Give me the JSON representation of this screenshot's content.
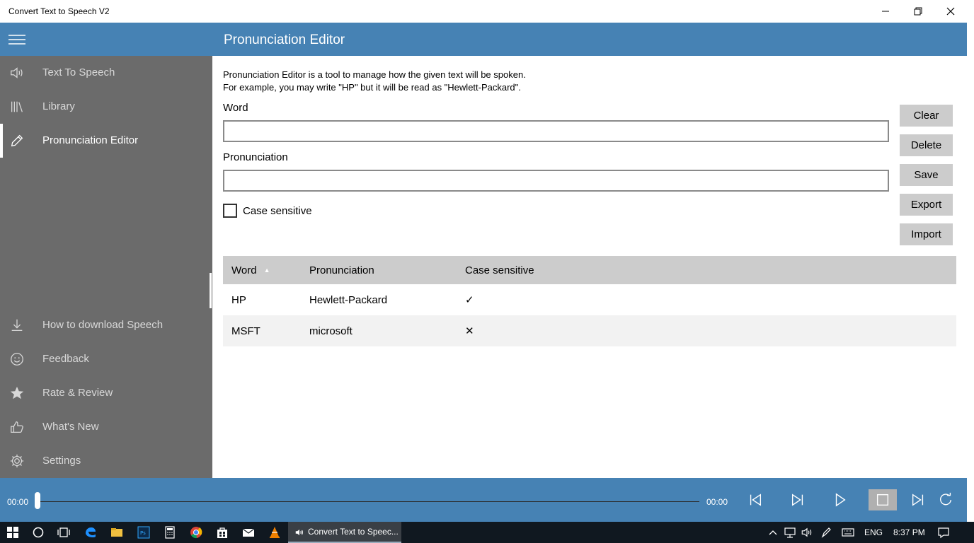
{
  "window": {
    "title": "Convert Text to Speech V2"
  },
  "header": {
    "title": "Pronunciation Editor"
  },
  "sidebar": {
    "top_items": [
      {
        "label": "Text To Speech",
        "icon": "speaker-icon",
        "active": false
      },
      {
        "label": "Library",
        "icon": "library-icon",
        "active": false
      },
      {
        "label": "Pronunciation Editor",
        "icon": "pencil-icon",
        "active": true
      }
    ],
    "bottom_items": [
      {
        "label": "How to download Speech",
        "icon": "download-icon"
      },
      {
        "label": "Feedback",
        "icon": "smiley-icon"
      },
      {
        "label": "Rate & Review",
        "icon": "star-icon"
      },
      {
        "label": "What's New",
        "icon": "thumbs-up-icon"
      },
      {
        "label": "Settings",
        "icon": "gear-icon"
      }
    ]
  },
  "main": {
    "description_line1": "Pronunciation Editor is a tool to manage how the given text will be spoken.",
    "description_line2": "For example, you may write \"HP\" but it will be read as \"Hewlett-Packard\".",
    "word_label": "Word",
    "word_value": "",
    "pronunciation_label": "Pronunciation",
    "pronunciation_value": "",
    "case_sensitive_label": "Case sensitive",
    "case_sensitive_checked": false,
    "buttons": {
      "clear": "Clear",
      "delete": "Delete",
      "save": "Save",
      "export": "Export",
      "import": "Import"
    }
  },
  "table": {
    "columns": [
      "Word",
      "Pronunciation",
      "Case sensitive"
    ],
    "sort_indicator": "▲",
    "rows": [
      {
        "word": "HP",
        "pronunciation": "Hewlett-Packard",
        "case_sensitive": "✓"
      },
      {
        "word": "MSFT",
        "pronunciation": "microsoft",
        "case_sensitive": "✕"
      }
    ]
  },
  "player": {
    "current_time": "00:00",
    "total_time": "00:00",
    "progress": 0
  },
  "taskbar": {
    "active_task": "Convert Text to Speec...",
    "language": "ENG",
    "clock": "8:37 PM"
  },
  "colors": {
    "accent": "#4682b4",
    "sidebar": "#6b6b6b",
    "button": "#cccccc"
  }
}
